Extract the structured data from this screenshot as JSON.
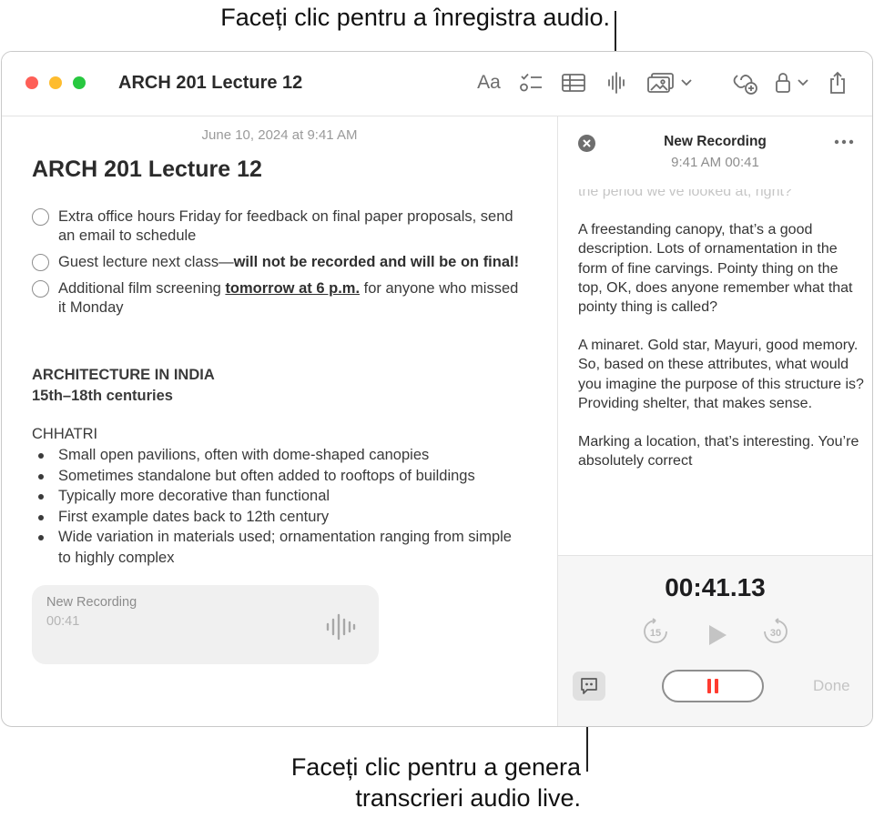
{
  "callouts": {
    "record_audio": "Faceți clic pentru a înregistra audio.",
    "live_transcript_line1": "Faceți clic pentru a genera",
    "live_transcript_line2": "transcrieri audio live."
  },
  "window": {
    "title": "ARCH 201 Lecture 12",
    "toolbar": {
      "format_label": "Aa",
      "icons": [
        "format-icon",
        "checklist-icon",
        "table-icon",
        "audio-waveform-icon",
        "media-icon",
        "chevron-down-icon",
        "collaborate-icon",
        "lock-icon",
        "share-icon"
      ]
    }
  },
  "note": {
    "date": "June 10, 2024 at 9:41 AM",
    "title": "ARCH 201 Lecture 12",
    "checklist": [
      {
        "text": "Extra office hours Friday for feedback on final paper proposals, send an email to schedule"
      },
      {
        "prefix": "Guest lecture next class—",
        "bold": "will not be recorded and will be on final!"
      },
      {
        "prefix": "Additional film screening ",
        "link": "tomorrow at 6 p.m.",
        "suffix": " for anyone who missed it Monday"
      }
    ],
    "section_heading_1": "ARCHITECTURE IN INDIA",
    "section_heading_2": "15th–18th centuries",
    "subsection": "CHHATRI",
    "bullets": [
      "Small open pavilions, often with dome-shaped canopies",
      "Sometimes standalone but often added to rooftops of buildings",
      "Typically more decorative than functional",
      "First example dates back to 12th century",
      "Wide variation in materials used; ornamentation ranging from simple to highly complex"
    ],
    "recording_card": {
      "title": "New Recording",
      "duration": "00:41"
    }
  },
  "recording_panel": {
    "title": "New Recording",
    "subtitle": "9:41 AM 00:41",
    "transcript": [
      "the period we’ve looked at, right?",
      "A freestanding canopy, that’s a good description. Lots of ornamentation in the form of fine carvings. Pointy thing on the top, OK, does anyone remember what that pointy thing is called?",
      "A minaret. Gold star, Mayuri, good memory. So, based on these attributes, what would you imagine the purpose of this structure is? Providing shelter, that makes sense.",
      "Marking a location, that’s interesting. You’re absolutely correct"
    ],
    "timer": "00:41.13",
    "skip_back": "15",
    "skip_forward": "30",
    "done_label": "Done",
    "pause_color": "#ff3b30"
  }
}
